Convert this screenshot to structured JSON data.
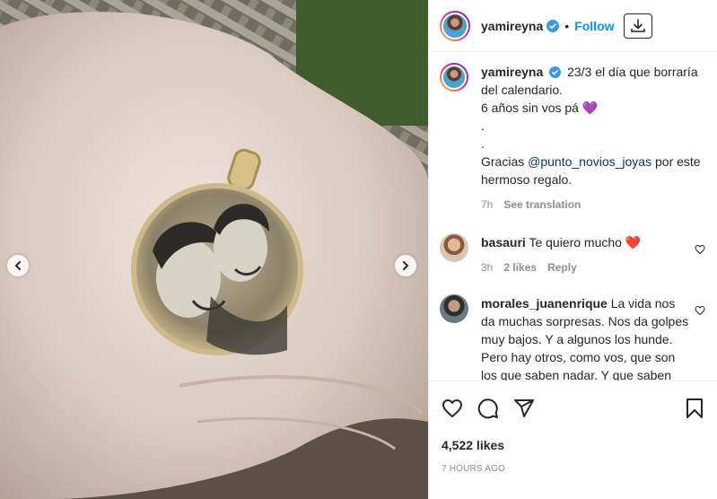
{
  "post": {
    "author": "yamireyna",
    "follow_label": "Follow",
    "separator": "•",
    "caption_lines": [
      "23/3 el día que borraría del calendario.",
      "6 años sin vos pá 💜",
      ".",
      "."
    ],
    "caption_thanks_pre": "Gracias ",
    "caption_mention": "@punto_novios_joyas",
    "caption_thanks_post": " por este hermoso regalo.",
    "caption_age": "7h",
    "see_translation": "See translation"
  },
  "comments": [
    {
      "user": "basauri",
      "text": "Te quiero mucho ❤️",
      "age": "3h",
      "likes": "2 likes",
      "reply": "Reply"
    },
    {
      "user": "morales_juanenrique",
      "text": "La vida nos da muchas sorpresas. Nos da golpes muy bajos. Y a algunos los hunde. Pero hay otros, como vos, que son los que saben nadar. Y que saben llegar hasta arriba para no ahogarse. Esa fuerza que hoy muestra te la dejó él."
    }
  ],
  "footer": {
    "likes": "4,522 likes",
    "time": "7 hours ago"
  },
  "icons": {
    "verified": "verified-badge-icon",
    "download": "download-icon",
    "like": "heart-icon",
    "comment": "comment-icon",
    "share": "share-icon",
    "save": "bookmark-icon",
    "prev": "chevron-left-icon",
    "next": "chevron-right-icon"
  },
  "colors": {
    "accent": "#0095f6",
    "verified": "#3897f0",
    "mention": "#00376b",
    "muted": "#8e8e8e"
  }
}
